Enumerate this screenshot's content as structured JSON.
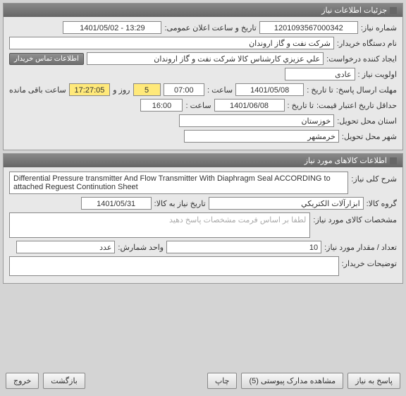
{
  "panel1": {
    "title": "جزئیات اطلاعات نیاز",
    "req_no_label": "شماره نیاز:",
    "req_no": "1201093567000342",
    "ann_date_label": "تاریخ و ساعت اعلان عمومی:",
    "ann_date": "1401/05/02 - 13:29",
    "buyer_label": "نام دستگاه خریدار:",
    "buyer": "شرکت نفت و گاز اروندان",
    "creator_label": "ایجاد کننده درخواست:",
    "creator": "علي عزيزي كارشناس كالا شركت نفت و گاز اروندان",
    "contact_btn": "اطلاعات تماس خریدار",
    "priority_label": "اولویت نیاز :",
    "priority": "عادی",
    "deadline_send_label": "مهلت ارسال پاسخ:",
    "to_date_label": "تا تاریخ :",
    "date1": "1401/05/08",
    "time_label": "ساعت :",
    "time1": "07:00",
    "days": "5",
    "days_label": "روز و",
    "countdown": "17:27:05",
    "countdown_label": "ساعت باقی مانده",
    "min_valid_label": "حداقل تاریخ اعتبار قیمت:",
    "date2": "1401/06/08",
    "time2": "16:00",
    "province_label": "استان محل تحویل:",
    "province": "خوزستان",
    "city_label": "شهر محل تحویل:",
    "city": "خرمشهر"
  },
  "panel2": {
    "title": "اطلاعات کالاهای مورد نیاز",
    "desc_label": "شرح کلی نیاز:",
    "desc": "Differential Pressure transmitter And Flow Transmitter With Diaphragm Seal  ACCORDING to attached Reguest Continution Sheet",
    "group_label": "گروه کالا:",
    "group": "ابزارآلات الكتريكي",
    "item_date_label": "تاریخ نیاز به کالا:",
    "item_date": "1401/05/31",
    "spec_label": "مشخصات کالای مورد نیاز:",
    "spec_placeholder": "لطفا بر اساس فرمت مشخصات پاسخ دهید",
    "qty_label": "تعداد / مقدار مورد نیاز:",
    "qty": "10",
    "unit_label": "واحد شمارش:",
    "unit": "عدد",
    "buyer_notes_label": "توضیحات خریدار:"
  },
  "buttons": {
    "respond": "پاسخ به نیاز",
    "attachments": "مشاهده مدارک پیوستی (5)",
    "print": "چاپ",
    "back": "بازگشت",
    "exit": "خروج"
  }
}
